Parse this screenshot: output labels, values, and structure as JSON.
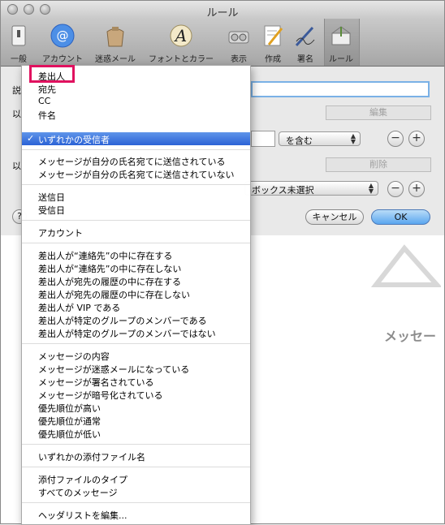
{
  "window": {
    "title": "ルール"
  },
  "toolbar": {
    "items": [
      {
        "label": "一般",
        "icon": "switch-icon"
      },
      {
        "label": "アカウント",
        "icon": "at-sign-icon"
      },
      {
        "label": "迷惑メール",
        "icon": "trash-bag-icon"
      },
      {
        "label": "フォントとカラー",
        "icon": "font-icon"
      },
      {
        "label": "表示",
        "icon": "glasses-icon"
      },
      {
        "label": "作成",
        "icon": "pencil-note-icon"
      },
      {
        "label": "署名",
        "icon": "signature-pen-icon"
      },
      {
        "label": "ルール",
        "icon": "envelope-rules-icon"
      }
    ]
  },
  "sheet": {
    "description_prefix": "説",
    "condition_prefix_1": "以",
    "condition_prefix_2": "以",
    "operator_value": "を含む",
    "action_value": "ボックス未選択",
    "cancel_label": "キャンセル",
    "ok_label": "OK",
    "help_label": "?",
    "edit_button": "編集",
    "delete_button": "削除"
  },
  "background": {
    "message_text": "メッセー"
  },
  "menu": {
    "items": [
      {
        "label": "差出人"
      },
      {
        "label": "宛先"
      },
      {
        "label": "CC"
      },
      {
        "label": "件名"
      },
      {
        "label": "いずれかの受信者",
        "selected": true,
        "check": "✓"
      },
      {
        "label": "メッセージが自分の氏名宛てに送信されている"
      },
      {
        "label": "メッセージが自分の氏名宛てに送信されていない"
      },
      {
        "label": "送信日"
      },
      {
        "label": "受信日"
      },
      {
        "label": "アカウント"
      },
      {
        "label": "差出人が“連絡先”の中に存在する"
      },
      {
        "label": "差出人が“連絡先”の中に存在しない"
      },
      {
        "label": "差出人が宛先の履歴の中に存在する"
      },
      {
        "label": "差出人が宛先の履歴の中に存在しない"
      },
      {
        "label": "差出人が VIP である"
      },
      {
        "label": "差出人が特定のグループのメンバーである"
      },
      {
        "label": "差出人が特定のグループのメンバーではない"
      },
      {
        "label": "メッセージの内容"
      },
      {
        "label": "メッセージが迷惑メールになっている"
      },
      {
        "label": "メッセージが署名されている"
      },
      {
        "label": "メッセージが暗号化されている"
      },
      {
        "label": "優先順位が高い"
      },
      {
        "label": "優先順位が通常"
      },
      {
        "label": "優先順位が低い"
      },
      {
        "label": "いずれかの添付ファイル名"
      },
      {
        "label": "添付ファイルのタイプ"
      },
      {
        "label": "すべてのメッセージ"
      },
      {
        "label": "ヘッダリストを編集..."
      }
    ]
  },
  "colors": {
    "highlight_box": "#e0115f",
    "selection": "#2b62d5"
  }
}
